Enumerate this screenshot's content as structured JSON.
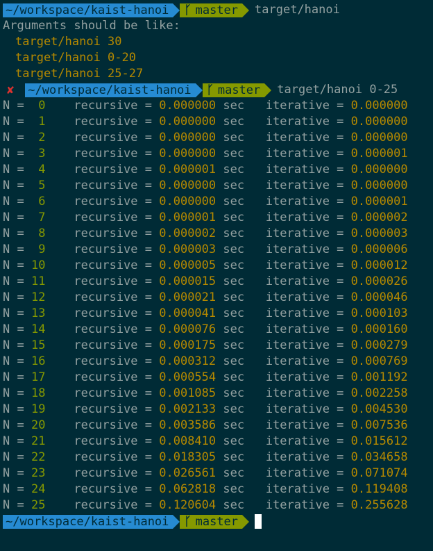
{
  "prompt": {
    "dir": "~/workspace/kaist-hanoi",
    "branch": "master",
    "branch_icon": "branch-icon",
    "error_mark": "✘"
  },
  "commands": {
    "first": "target/hanoi",
    "second": "target/hanoi 0-25"
  },
  "usage": {
    "header": "Arguments should be like:",
    "examples": [
      "target/hanoi 30",
      "target/hanoi 0-20",
      "target/hanoi 25-27"
    ]
  },
  "labels": {
    "n_prefix": "N =",
    "recursive": "recursive =",
    "sec": "sec",
    "iterative": "iterative ="
  },
  "results": [
    {
      "n": "0",
      "recursive": "0.000000",
      "iterative": "0.000000"
    },
    {
      "n": "1",
      "recursive": "0.000000",
      "iterative": "0.000000"
    },
    {
      "n": "2",
      "recursive": "0.000000",
      "iterative": "0.000000"
    },
    {
      "n": "3",
      "recursive": "0.000000",
      "iterative": "0.000001"
    },
    {
      "n": "4",
      "recursive": "0.000001",
      "iterative": "0.000000"
    },
    {
      "n": "5",
      "recursive": "0.000000",
      "iterative": "0.000000"
    },
    {
      "n": "6",
      "recursive": "0.000000",
      "iterative": "0.000001"
    },
    {
      "n": "7",
      "recursive": "0.000001",
      "iterative": "0.000002"
    },
    {
      "n": "8",
      "recursive": "0.000002",
      "iterative": "0.000003"
    },
    {
      "n": "9",
      "recursive": "0.000003",
      "iterative": "0.000006"
    },
    {
      "n": "10",
      "recursive": "0.000005",
      "iterative": "0.000012"
    },
    {
      "n": "11",
      "recursive": "0.000015",
      "iterative": "0.000026"
    },
    {
      "n": "12",
      "recursive": "0.000021",
      "iterative": "0.000046"
    },
    {
      "n": "13",
      "recursive": "0.000041",
      "iterative": "0.000103"
    },
    {
      "n": "14",
      "recursive": "0.000076",
      "iterative": "0.000160"
    },
    {
      "n": "15",
      "recursive": "0.000175",
      "iterative": "0.000279"
    },
    {
      "n": "16",
      "recursive": "0.000312",
      "iterative": "0.000769"
    },
    {
      "n": "17",
      "recursive": "0.000554",
      "iterative": "0.001192"
    },
    {
      "n": "18",
      "recursive": "0.001085",
      "iterative": "0.002258"
    },
    {
      "n": "19",
      "recursive": "0.002133",
      "iterative": "0.004530"
    },
    {
      "n": "20",
      "recursive": "0.003586",
      "iterative": "0.007536"
    },
    {
      "n": "21",
      "recursive": "0.008410",
      "iterative": "0.015612"
    },
    {
      "n": "22",
      "recursive": "0.018305",
      "iterative": "0.034658"
    },
    {
      "n": "23",
      "recursive": "0.026561",
      "iterative": "0.071074"
    },
    {
      "n": "24",
      "recursive": "0.062818",
      "iterative": "0.119408"
    },
    {
      "n": "25",
      "recursive": "0.120604",
      "iterative": "0.255628"
    }
  ],
  "colors": {
    "background": "#002b36",
    "dir_segment": "#268bd2",
    "git_segment": "#859900",
    "value": "#b58900",
    "error": "#dc322f"
  }
}
